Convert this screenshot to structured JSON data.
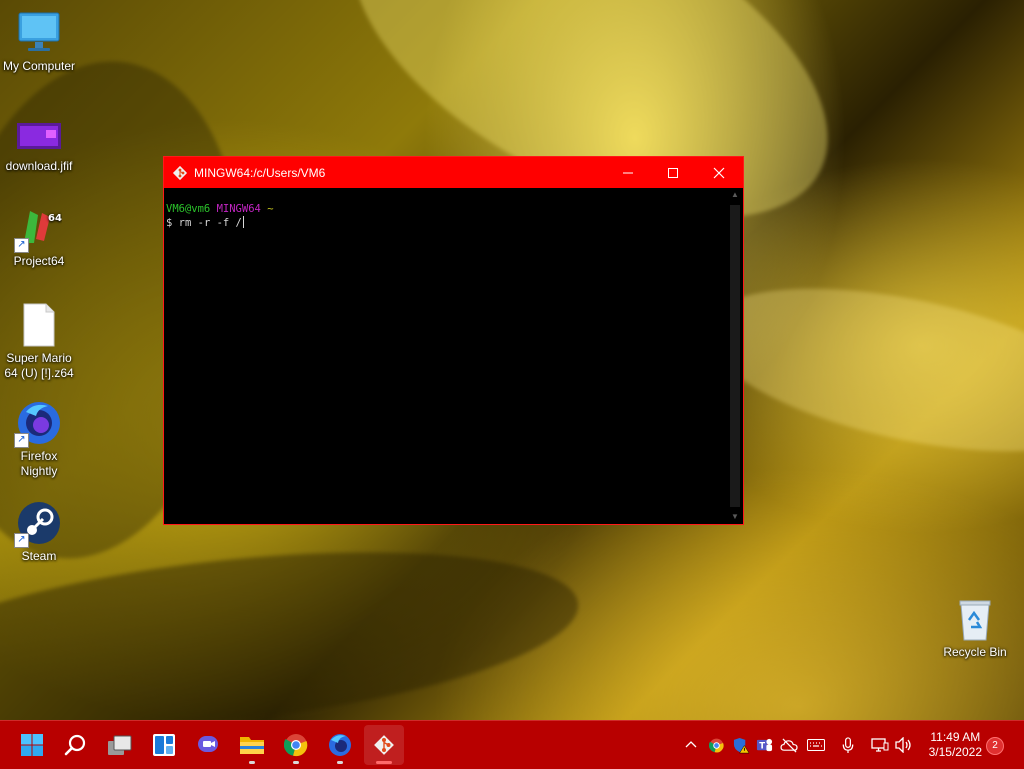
{
  "desktop": {
    "icons": [
      {
        "label": "My Computer",
        "icon": "monitor-icon"
      },
      {
        "label": "download.jfif",
        "icon": "image-file-icon"
      },
      {
        "label": "Project64",
        "icon": "project64-icon",
        "shortcut": true
      },
      {
        "label": "Super Mario 64 (U) [!].z64",
        "icon": "blank-file-icon"
      },
      {
        "label": "Firefox Nightly",
        "icon": "firefox-nightly-icon",
        "shortcut": true
      },
      {
        "label": "Steam",
        "icon": "steam-icon",
        "shortcut": true
      },
      {
        "label": "Recycle Bin",
        "icon": "recycle-bin-icon"
      }
    ]
  },
  "window": {
    "title": "MINGW64:/c/Users/VM6",
    "minimize_label": "—",
    "maximize_label": "☐",
    "close_label": "✕",
    "prompt": {
      "user_host": "VM6@vm6",
      "system": "MINGW64",
      "path": "~",
      "symbol": "$",
      "command": "rm -r -f /"
    }
  },
  "taskbar": {
    "apps": [
      {
        "name": "start",
        "icon": "windows-logo-icon"
      },
      {
        "name": "search",
        "icon": "search-icon"
      },
      {
        "name": "task-view",
        "icon": "task-view-icon"
      },
      {
        "name": "widgets",
        "icon": "widgets-icon"
      },
      {
        "name": "teams-chat",
        "icon": "chat-icon"
      },
      {
        "name": "file-explorer",
        "icon": "folder-icon",
        "running": true
      },
      {
        "name": "chrome",
        "icon": "chrome-icon",
        "running": true
      },
      {
        "name": "firefox",
        "icon": "firefox-icon",
        "running": true
      },
      {
        "name": "git-bash",
        "icon": "git-icon",
        "running": true,
        "active": true
      }
    ],
    "tray_icons": [
      "chevron-up-icon",
      "chrome-tray-icon",
      "defender-warning-icon",
      "teams-icon",
      "onedrive-off-icon",
      "keyboard-icon",
      "microphone-icon",
      "network-icon",
      "volume-icon"
    ],
    "time": "11:49 AM",
    "date": "3/15/2022",
    "notification_count": "2"
  },
  "colors": {
    "taskbar": "#b80000",
    "titlebar": "#ff0000",
    "prompt_green": "#2bc42b",
    "prompt_magenta": "#c425c4",
    "prompt_yellow": "#c8c820"
  }
}
